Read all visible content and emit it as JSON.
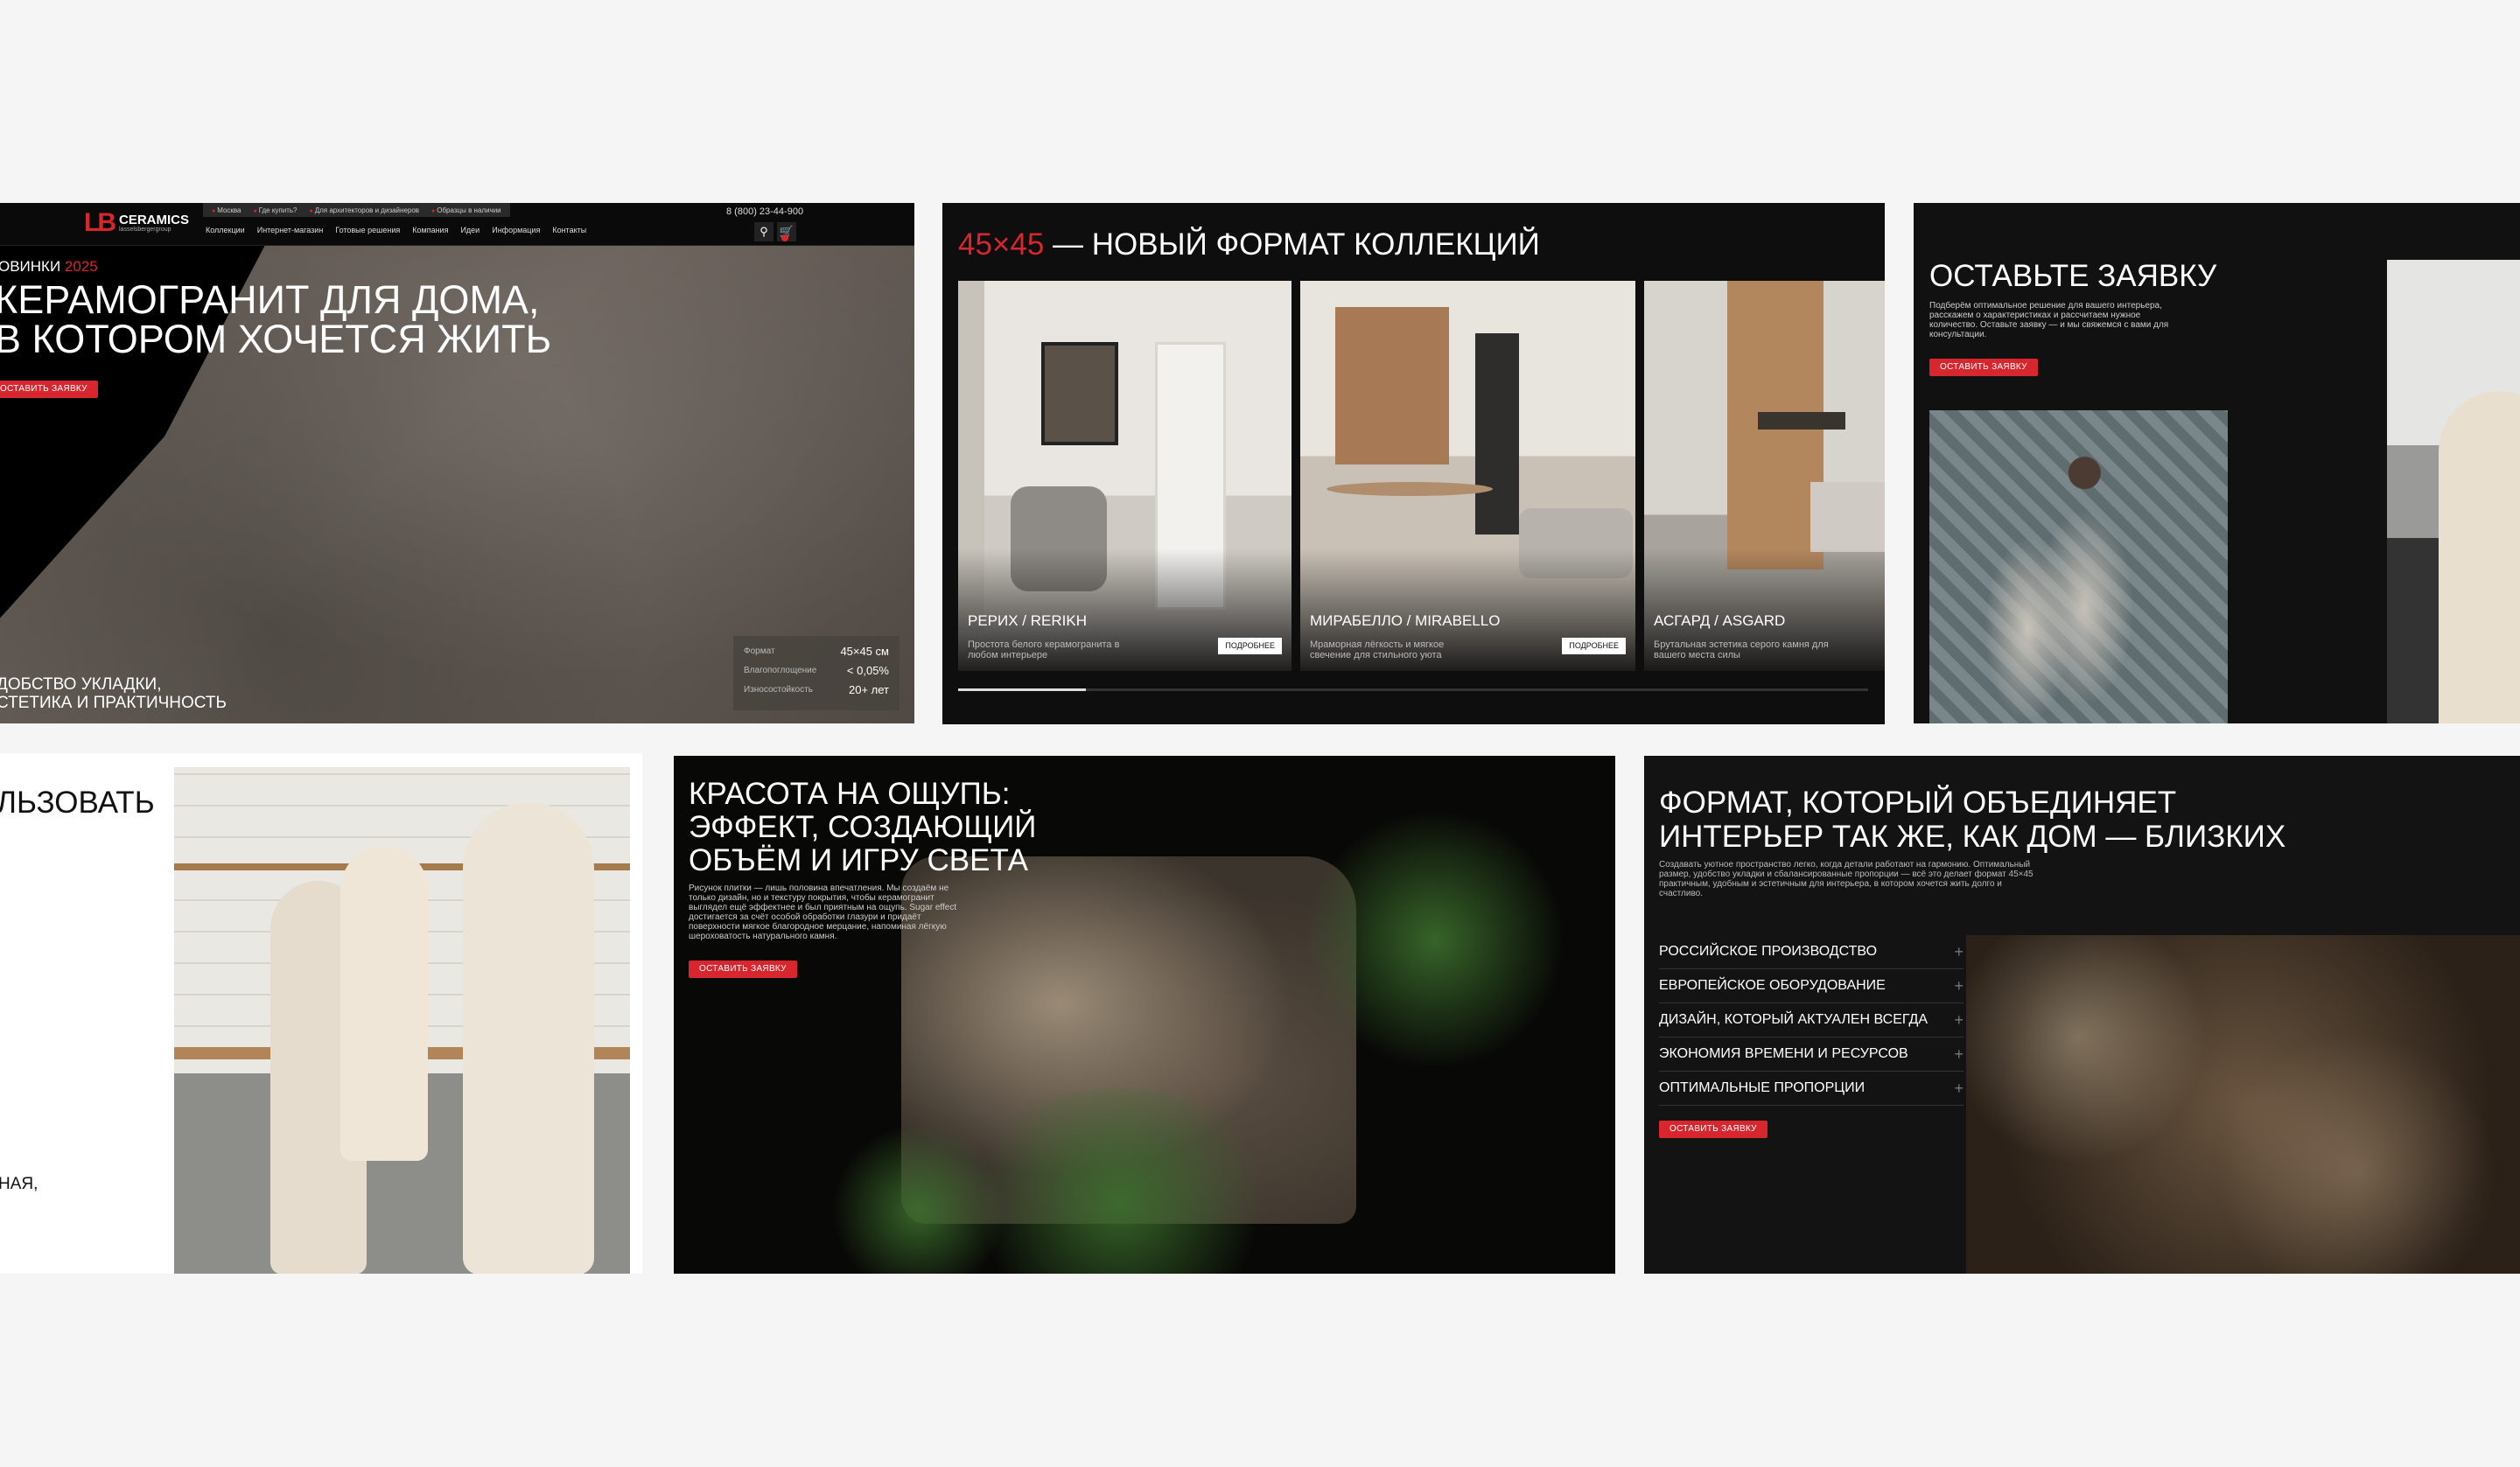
{
  "hero": {
    "logo_mark": "LB",
    "logo_word": "CERAMICS",
    "logo_sub": "lasselsbergergroup",
    "util_links": [
      "Москва",
      "Где купить?",
      "Для архитекторов и дизайнеров",
      "Образцы в наличии"
    ],
    "nav": [
      "Коллекции",
      "Интернет-магазин",
      "Готовые решения",
      "Компания",
      "Идеи",
      "Информация",
      "Контакты"
    ],
    "phone": "8 (800) 23-44-900",
    "tag_prefix": "ОВИНКИ",
    "tag_year": "2025",
    "headline_line1": "КЕРАМОГРАНИТ ДЛЯ ДОМА,",
    "headline_line2": "В КОТОРОМ ХОЧЕТСЯ ЖИТЬ",
    "cta": "ОСТАВИТЬ ЗАЯВКУ",
    "specs": [
      {
        "k": "Формат",
        "v": "45×45 см"
      },
      {
        "k": "Влагопоглощение",
        "v": "< 0,05%"
      },
      {
        "k": "Износостойкость",
        "v": "20+ лет"
      }
    ],
    "bottom_line1": "ДОБСТВО УКЛАДКИ,",
    "bottom_line2": "СТЕТИКА И ПРАКТИЧНОСТЬ"
  },
  "collections": {
    "title_accent": "45×45",
    "title_rest": " — НОВЫЙ ФОРМАТ КОЛЛЕКЦИЙ",
    "cards": [
      {
        "name": "РЕРИХ / RERIKH",
        "desc": "Простота белого керамогранита в любом интерьере",
        "more": "ПОДРОБНЕЕ"
      },
      {
        "name": "МИРАБЕЛЛО / MIRABELLO",
        "desc": "Мраморная лёгкость и мягкое свечение для стильного уюта",
        "more": "ПОДРОБНЕЕ"
      },
      {
        "name": "АСГАРД / ASGARD",
        "desc": "Брутальная эстетика серого камня для вашего места силы",
        "more": ""
      }
    ],
    "progress": 0.14
  },
  "request": {
    "title": "ОСТАВЬТЕ ЗАЯВКУ",
    "text": "Подберём оптимальное решение для вашего интерьера, расскажем о характеристиках и рассчитаем нужное количество. Оставьте заявку — и мы свяжемся с вами для консультации.",
    "cta": "ОСТАВИТЬ ЗАЯВКУ"
  },
  "family": {
    "title_fragment": "ЛЬЗОВАТЬ",
    "text_fragment": "НАЯ,"
  },
  "beauty": {
    "title_line1": "КРАСОТА НА ОЩУПЬ:",
    "title_line2": "ЭФФЕКТ, СОЗДАЮЩИЙ",
    "title_line3": "ОБЪЁМ И ИГРУ СВЕТА",
    "text": "Рисунок плитки — лишь половина впечатления. Мы создаём не только дизайн, но и текстуру покрытия, чтобы керамогранит выглядел ещё эффектнее и был приятным на ощупь. Sugar effect достигается за счёт особой обработки глазури и придаёт поверхности мягкое благородное мерцание, напоминая лёгкую шероховатость натурального камня.",
    "cta": "ОСТАВИТЬ ЗАЯВКУ"
  },
  "format": {
    "title_line1": "ФОРМАТ, КОТОРЫЙ ОБЪЕДИНЯЕТ",
    "title_line2": "ИНТЕРЬЕР ТАК ЖЕ, КАК ДОМ — БЛИЗКИХ",
    "text": "Создавать уютное пространство легко, когда детали работают на гармонию. Оптимальный размер, удобство укладки и сбалансированные пропорции — всё это делает формат 45×45 практичным, удобным и эстетичным для интерьера, в котором хочется жить долго и счастливо.",
    "items": [
      "РОССИЙСКОЕ ПРОИЗВОДСТВО",
      "ЕВРОПЕЙСКОЕ ОБОРУДОВАНИЕ",
      "ДИЗАЙН, КОТОРЫЙ АКТУАЛЕН ВСЕГДА",
      "ЭКОНОМИЯ ВРЕМЕНИ И РЕСУРСОВ",
      "ОПТИМАЛЬНЫЕ ПРОПОРЦИИ"
    ],
    "cta": "ОСТАВИТЬ ЗАЯВКУ"
  }
}
